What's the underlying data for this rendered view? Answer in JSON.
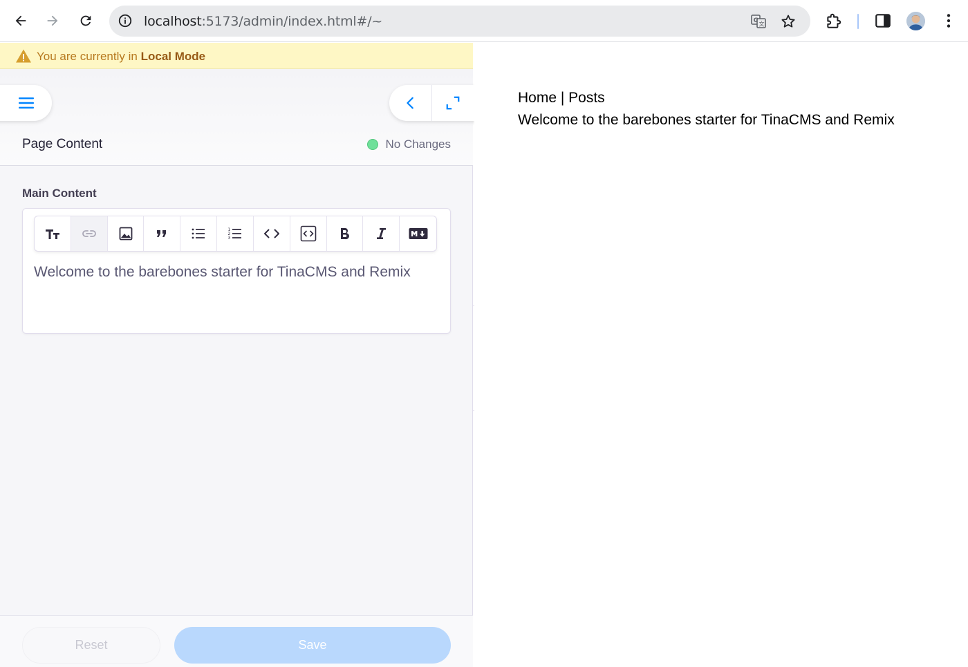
{
  "browser": {
    "url_host": "localhost",
    "url_rest": ":5173/admin/index.html#/~"
  },
  "banner": {
    "prefix": "You are currently in",
    "mode": "Local Mode"
  },
  "form": {
    "title": "Page Content",
    "status": "No Changes",
    "status_color": "#6fe09a",
    "field_label": "Main Content",
    "editor_text": "Welcome to the barebones starter for TinaCMS and Remix",
    "toolbar": [
      "heading-icon",
      "link-icon",
      "image-icon",
      "quote-icon",
      "bullet-list-icon",
      "ordered-list-icon",
      "code-icon",
      "code-block-icon",
      "bold-icon",
      "italic-icon",
      "markdown-icon"
    ]
  },
  "footer": {
    "reset_label": "Reset",
    "save_label": "Save"
  },
  "preview": {
    "nav": "Home | Posts",
    "message": "Welcome to the barebones starter for TinaCMS and Remix"
  },
  "colors": {
    "accent": "#0084ff",
    "save_disabled": "#b9d8fd",
    "banner_bg": "#fef7c5"
  }
}
